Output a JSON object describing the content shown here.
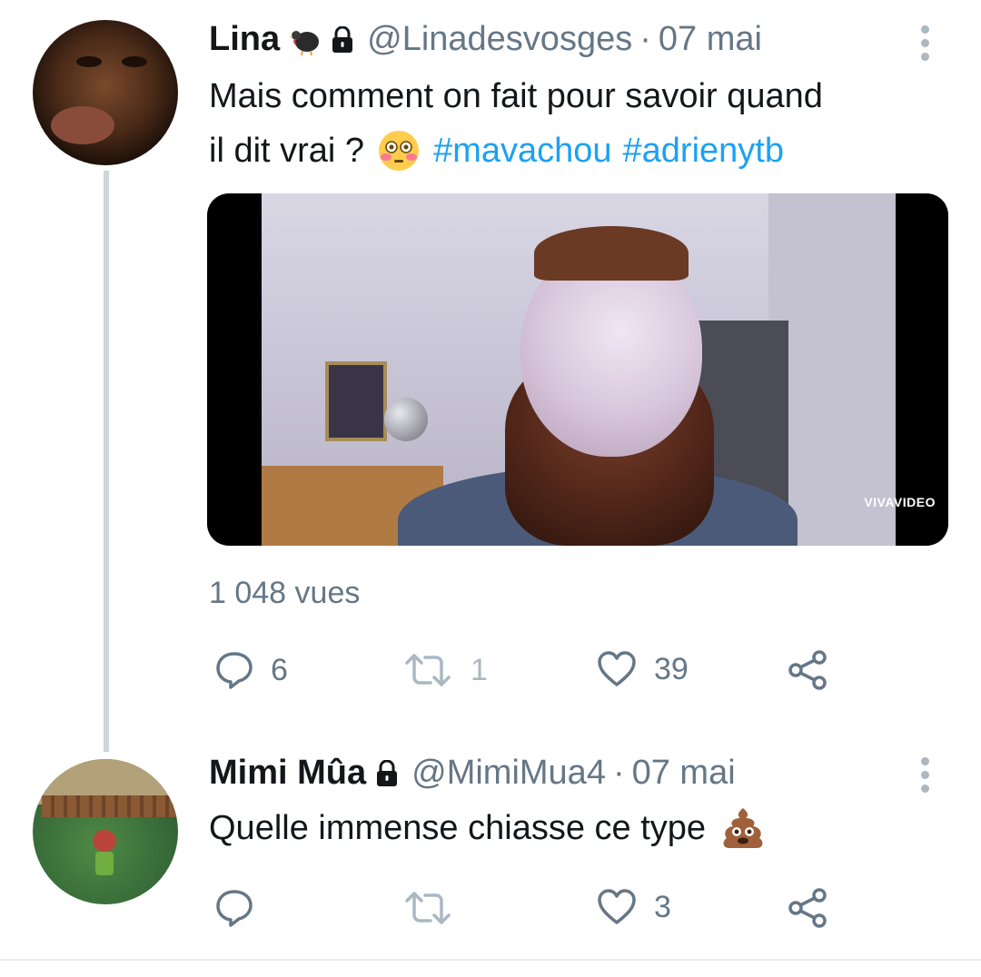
{
  "tweet1": {
    "name": "Lina",
    "handle": "@Linadesvosges",
    "separator": "·",
    "date": "07 mai",
    "text_line1": "Mais comment on fait pour savoir quand",
    "text_line2_prefix": "il dit vrai ?",
    "hashtag1": "#mavachou",
    "hashtag2": "#adrienytb",
    "media_watermark": "VIVAVIDEO",
    "views": "1 048 vues",
    "reply_count": "6",
    "retweet_count": "1",
    "like_count": "39",
    "name_emoji": "turkey-icon",
    "text_emoji": "flushed-face-icon"
  },
  "tweet2": {
    "name": "Mimi Mûa",
    "handle": "@MimiMua4",
    "separator": "·",
    "date": "07 mai",
    "text": "Quelle immense chiasse ce type",
    "text_emoji": "pile-of-poo-icon",
    "like_count": "3"
  },
  "colors": {
    "link": "#1da1f2",
    "secondary": "#657786",
    "thread_line": "#ccd6dd"
  }
}
